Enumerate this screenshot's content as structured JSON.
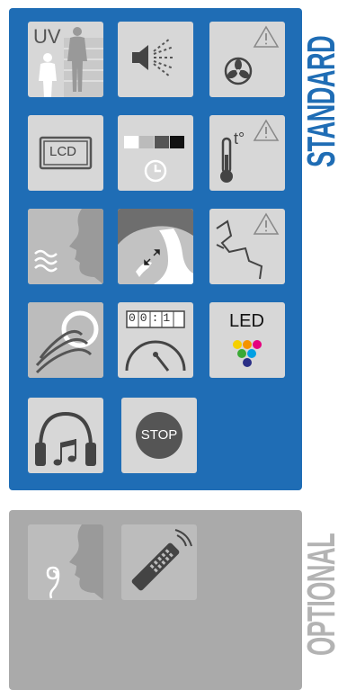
{
  "standard": {
    "label": "STANDARD",
    "tiles": [
      {
        "name": "uv-tile",
        "text": "UV"
      },
      {
        "name": "spray-tile"
      },
      {
        "name": "fan-warning-tile"
      },
      {
        "name": "lcd-tile",
        "text": "LCD"
      },
      {
        "name": "brightness-timer-tile"
      },
      {
        "name": "temperature-warning-tile",
        "text": "t°"
      },
      {
        "name": "breath-tile"
      },
      {
        "name": "water-pressure-tile"
      },
      {
        "name": "crack-warning-tile"
      },
      {
        "name": "air-flow-tile"
      },
      {
        "name": "timer-counter-tile",
        "digits": "00:1"
      },
      {
        "name": "led-tile",
        "text": "LED"
      },
      {
        "name": "audio-tile"
      },
      {
        "name": "stop-tile",
        "text": "STOP"
      }
    ]
  },
  "optional": {
    "label": "OPTIONAL",
    "tiles": [
      {
        "name": "aroma-tile"
      },
      {
        "name": "remote-control-tile"
      }
    ]
  },
  "colors": {
    "standard_panel": "#1f6db5",
    "optional_panel": "#aaaaaa",
    "tile": "#d7d7d7",
    "icon": "#555555"
  }
}
